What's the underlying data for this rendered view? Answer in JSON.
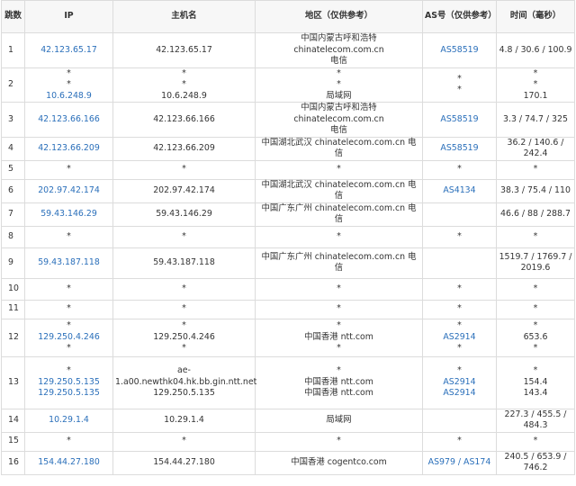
{
  "colors": {
    "link": "#2a6fba",
    "text": "#333333",
    "border": "#dcdcdc",
    "header_bg": "#f7f7f7"
  },
  "table": {
    "headers": [
      "跳数",
      "IP",
      "主机名",
      "地区（仅供参考）",
      "AS号（仅供参考）",
      "时间（毫秒）"
    ],
    "rows": [
      {
        "hop": "1",
        "ip": [
          "42.123.65.17"
        ],
        "host": [
          "42.123.65.17"
        ],
        "region": [
          "中国内蒙古呼和浩特 chinatelecom.com.cn",
          "电信"
        ],
        "as": [
          "AS58519"
        ],
        "time": [
          "4.8 / 30.6 / 100.9"
        ]
      },
      {
        "hop": "2",
        "ip": [
          "*",
          "*",
          "10.6.248.9"
        ],
        "host": [
          "*",
          "*",
          "10.6.248.9"
        ],
        "region": [
          "*",
          "*",
          "局域网"
        ],
        "as": [
          "*",
          "*"
        ],
        "time": [
          "*",
          "*",
          "170.1"
        ]
      },
      {
        "hop": "3",
        "ip": [
          "42.123.66.166"
        ],
        "host": [
          "42.123.66.166"
        ],
        "region": [
          "中国内蒙古呼和浩特 chinatelecom.com.cn",
          "电信"
        ],
        "as": [
          "AS58519"
        ],
        "time": [
          "3.3 / 74.7 / 325"
        ]
      },
      {
        "hop": "4",
        "ip": [
          "42.123.66.209"
        ],
        "host": [
          "42.123.66.209"
        ],
        "region": [
          "中国湖北武汉 chinatelecom.com.cn 电信"
        ],
        "as": [
          "AS58519"
        ],
        "time": [
          "36.2 / 140.6 / 242.4"
        ]
      },
      {
        "hop": "5",
        "ip": [
          "*"
        ],
        "host": [
          "*"
        ],
        "region": [
          "*"
        ],
        "as": [
          "*"
        ],
        "time": [
          "*"
        ]
      },
      {
        "hop": "6",
        "ip": [
          "202.97.42.174"
        ],
        "host": [
          "202.97.42.174"
        ],
        "region": [
          "中国湖北武汉 chinatelecom.com.cn 电信"
        ],
        "as": [
          "AS4134"
        ],
        "time": [
          "38.3 / 75.4 / 110"
        ]
      },
      {
        "hop": "7",
        "ip": [
          "59.43.146.29"
        ],
        "host": [
          "59.43.146.29"
        ],
        "region": [
          "中国广东广州 chinatelecom.com.cn 电信"
        ],
        "as": [],
        "time": [
          "46.6 / 88 / 288.7"
        ]
      },
      {
        "hop": "8",
        "ip": [
          "*"
        ],
        "host": [
          "*"
        ],
        "region": [
          "*"
        ],
        "as": [
          "*"
        ],
        "time": [
          "*"
        ]
      },
      {
        "hop": "9",
        "ip": [
          "59.43.187.118"
        ],
        "host": [
          "59.43.187.118"
        ],
        "region": [
          "中国广东广州 chinatelecom.com.cn 电信"
        ],
        "as": [],
        "time": [
          "1519.7 / 1769.7 /",
          "2019.6"
        ]
      },
      {
        "hop": "10",
        "ip": [
          "*"
        ],
        "host": [
          "*"
        ],
        "region": [
          "*"
        ],
        "as": [
          "*"
        ],
        "time": [
          "*"
        ]
      },
      {
        "hop": "11",
        "ip": [
          "*"
        ],
        "host": [
          "*"
        ],
        "region": [
          "*"
        ],
        "as": [
          "*"
        ],
        "time": [
          "*"
        ]
      },
      {
        "hop": "12",
        "ip": [
          "*",
          "129.250.4.246",
          "*"
        ],
        "host": [
          "*",
          "129.250.4.246",
          "*"
        ],
        "region": [
          "*",
          "中国香港 ntt.com",
          "*"
        ],
        "as": [
          "*",
          "AS2914",
          "*"
        ],
        "time": [
          "*",
          "653.6",
          "*"
        ]
      },
      {
        "hop": "13",
        "ip": [
          "*",
          "129.250.5.135",
          "129.250.5.135"
        ],
        "host": [
          "ae-",
          "1.a00.newthk04.hk.bb.gin.ntt.net",
          "129.250.5.135"
        ],
        "region": [
          "*",
          "中国香港 ntt.com",
          "中国香港 ntt.com"
        ],
        "as": [
          "*",
          "AS2914",
          "AS2914"
        ],
        "time": [
          "*",
          "154.4",
          "143.4"
        ]
      },
      {
        "hop": "14",
        "ip": [
          "10.29.1.4"
        ],
        "host": [
          "10.29.1.4"
        ],
        "region": [
          "局域网"
        ],
        "as": [],
        "time": [
          "227.3 / 455.5 / 484.3"
        ]
      },
      {
        "hop": "15",
        "ip": [
          "*"
        ],
        "host": [
          "*"
        ],
        "region": [
          "*"
        ],
        "as": [
          "*"
        ],
        "time": [
          "*"
        ]
      },
      {
        "hop": "16",
        "ip": [
          "154.44.27.180"
        ],
        "host": [
          "154.44.27.180"
        ],
        "region": [
          "中国香港 cogentco.com"
        ],
        "as": [
          "AS979 / AS174"
        ],
        "time": [
          "240.5 / 653.9 / 746.2"
        ]
      }
    ]
  }
}
